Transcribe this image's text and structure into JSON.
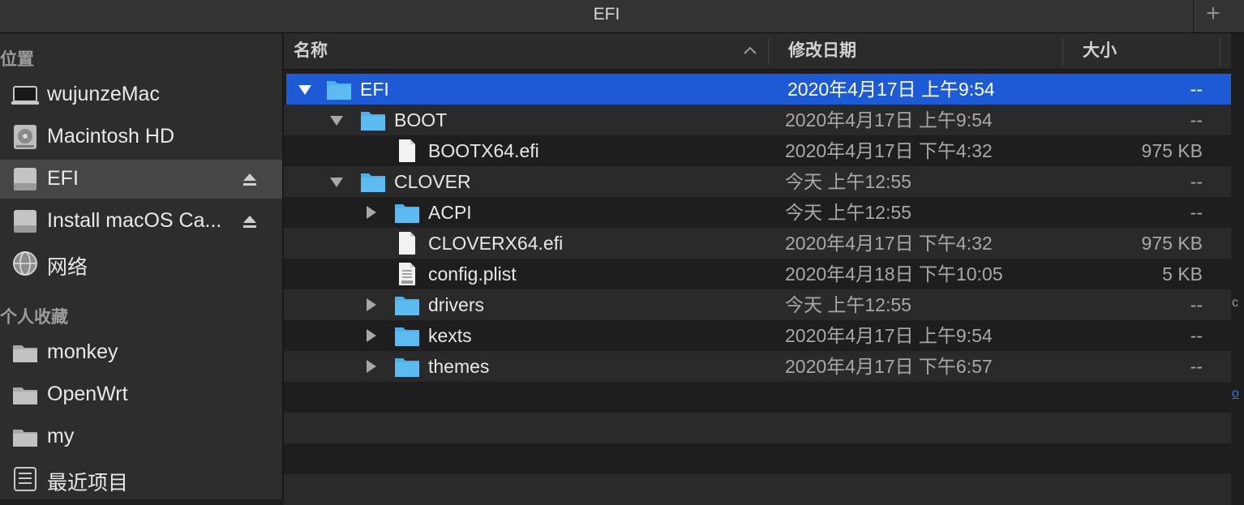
{
  "window": {
    "title": "EFI",
    "add_tab_label": "+"
  },
  "sidebar": {
    "locations_header": "位置",
    "favorites_header": "个人收藏",
    "locations": [
      {
        "label": "wujunzeMac",
        "icon": "laptop-icon",
        "eject": false
      },
      {
        "label": "Macintosh HD",
        "icon": "harddisk-icon",
        "eject": false
      },
      {
        "label": "EFI",
        "icon": "drive-icon",
        "eject": true,
        "selected": true
      },
      {
        "label": "Install macOS Ca...",
        "icon": "drive-icon",
        "eject": true
      },
      {
        "label": "网络",
        "icon": "globe-icon",
        "eject": false
      }
    ],
    "favorites": [
      {
        "label": "monkey",
        "icon": "folder-icon"
      },
      {
        "label": "OpenWrt",
        "icon": "folder-icon"
      },
      {
        "label": "my",
        "icon": "folder-icon"
      },
      {
        "label": "最近项目",
        "icon": "recents-icon"
      }
    ]
  },
  "columns": {
    "name": "名称",
    "date": "修改日期",
    "size": "大小"
  },
  "rows": [
    {
      "name": "EFI",
      "date": "2020年4月17日 上午9:54",
      "size": "--",
      "level": 0,
      "kind": "folder",
      "disclosure": "open",
      "selected": true
    },
    {
      "name": "BOOT",
      "date": "2020年4月17日 上午9:54",
      "size": "--",
      "level": 1,
      "kind": "folder",
      "disclosure": "open"
    },
    {
      "name": "BOOTX64.efi",
      "date": "2020年4月17日 下午4:32",
      "size": "975 KB",
      "level": 2,
      "kind": "file",
      "disclosure": "none"
    },
    {
      "name": "CLOVER",
      "date": "今天 上午12:55",
      "size": "--",
      "level": 1,
      "kind": "folder",
      "disclosure": "open"
    },
    {
      "name": "ACPI",
      "date": "今天 上午12:55",
      "size": "--",
      "level": 2,
      "kind": "folder",
      "disclosure": "closed"
    },
    {
      "name": "CLOVERX64.efi",
      "date": "2020年4月17日 下午4:32",
      "size": "975 KB",
      "level": 2,
      "kind": "file",
      "disclosure": "none"
    },
    {
      "name": "config.plist",
      "date": "2020年4月18日 下午10:05",
      "size": "5 KB",
      "level": 2,
      "kind": "plist",
      "disclosure": "none"
    },
    {
      "name": "drivers",
      "date": "今天 上午12:55",
      "size": "--",
      "level": 2,
      "kind": "folder",
      "disclosure": "closed"
    },
    {
      "name": "kexts",
      "date": "2020年4月17日 上午9:54",
      "size": "--",
      "level": 2,
      "kind": "folder",
      "disclosure": "closed"
    },
    {
      "name": "themes",
      "date": "2020年4月17日 下午6:57",
      "size": "--",
      "level": 2,
      "kind": "folder",
      "disclosure": "closed"
    }
  ],
  "edge_fragments": {
    "right_top": "c",
    "right_bottom": "o"
  },
  "colors": {
    "selection": "#1d5bd6",
    "folder": "#4fb1e9",
    "sidebar": "#2d2d2d",
    "list_bg": "#1e1e1e"
  }
}
